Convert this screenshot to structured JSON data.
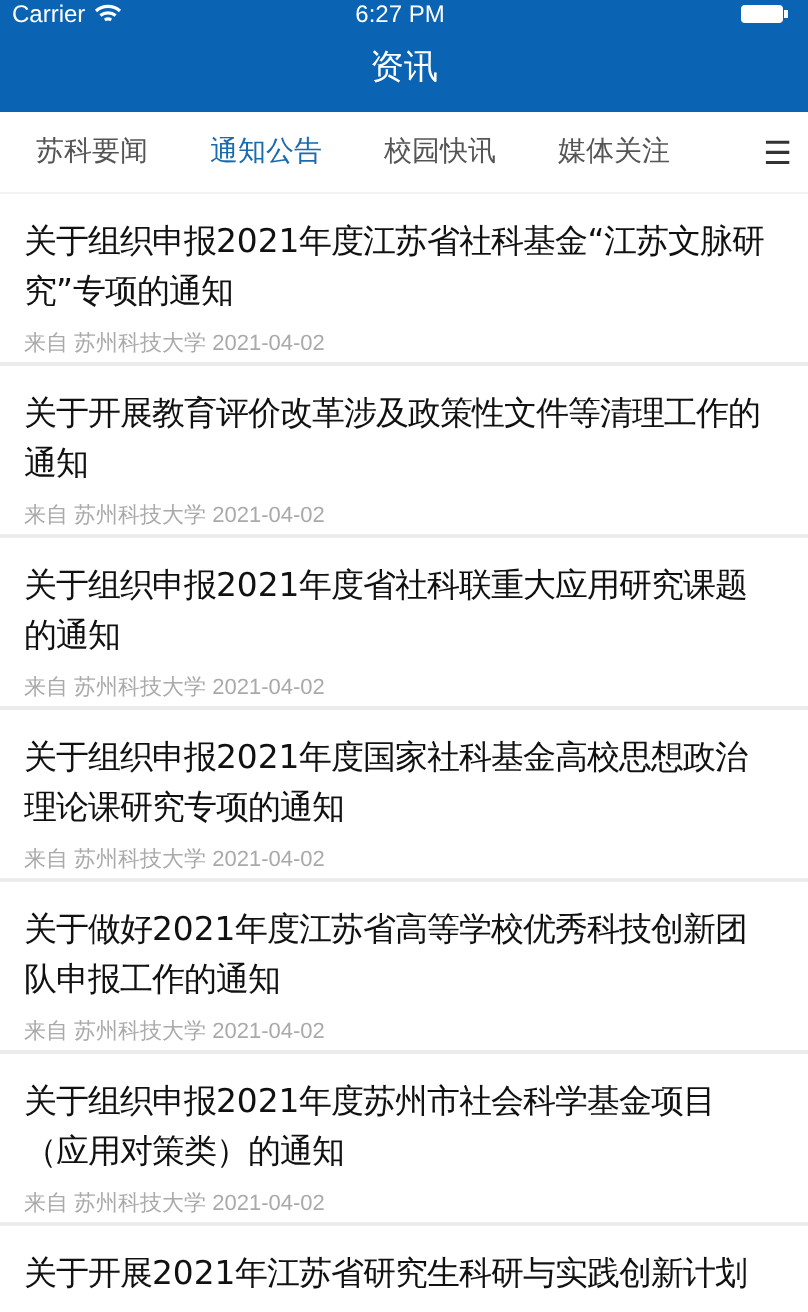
{
  "status_bar": {
    "carrier": "Carrier",
    "time": "6:27 PM"
  },
  "title": "资讯",
  "tabs": [
    {
      "label": "苏科要闻",
      "selected": false
    },
    {
      "label": "通知公告",
      "selected": true
    },
    {
      "label": "校园快讯",
      "selected": false
    },
    {
      "label": "媒体关注",
      "selected": false
    }
  ],
  "menu_icon": "☰",
  "articles": [
    {
      "title": "关于组织申报2021年度江苏省社科基金“江苏文脉研究”专项的通知",
      "meta": "来自 苏州科技大学 2021-04-02"
    },
    {
      "title": "关于开展教育评价改革涉及政策性文件等清理工作的通知",
      "meta": "来自 苏州科技大学 2021-04-02"
    },
    {
      "title": "关于组织申报2021年度省社科联重大应用研究课题的通知",
      "meta": "来自 苏州科技大学 2021-04-02"
    },
    {
      "title": "关于组织申报2021年度国家社科基金高校思想政治理论课研究专项的通知",
      "meta": "来自 苏州科技大学 2021-04-02"
    },
    {
      "title": "关于做好2021年度江苏省高等学校优秀科技创新团队申报工作的通知",
      "meta": "来自 苏州科技大学 2021-04-02"
    },
    {
      "title": "关于组织申报2021年度苏州市社会科学基金项目（应用对策类）的通知",
      "meta": "来自 苏州科技大学 2021-04-02"
    },
    {
      "title": "关于开展2021年江苏省研究生科研与实践创新计划"
    }
  ]
}
